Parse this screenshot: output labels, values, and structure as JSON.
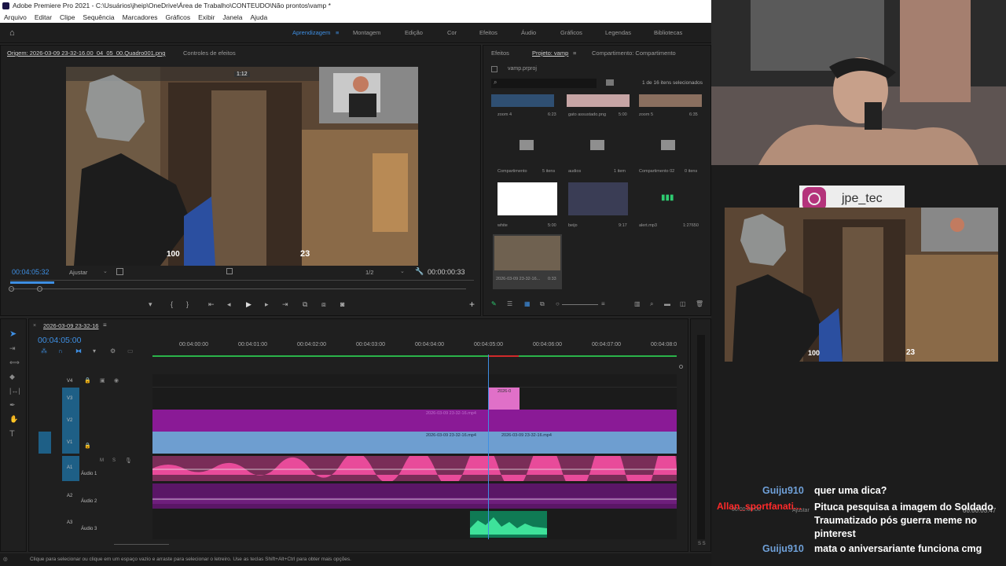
{
  "title_bar": "Adobe Premiere Pro 2021 - C:\\Usuários\\jheip\\OneDrive\\Área de Trabalho\\CONTEUDO\\Não prontos\\vamp *",
  "menu": [
    "Arquivo",
    "Editar",
    "Clipe",
    "Sequência",
    "Marcadores",
    "Gráficos",
    "Exibir",
    "Janela",
    "Ajuda"
  ],
  "workspaces": [
    "Aprendizagem",
    "Montagem",
    "Edição",
    "Cor",
    "Efeitos",
    "Áudio",
    "Gráficos",
    "Legendas",
    "Bibliotecas"
  ],
  "source_panel": {
    "tab_origin": "Origem: 2026-03-09 23-32-16.00_04_05_00.Quadro001.png",
    "tab_effects": "Controles de efeitos",
    "timecode_left": "00:04:05:32",
    "fit": "Ajustar",
    "resolution": "1/2",
    "timecode_right": "00:00:00:33",
    "hud_time": "1:12",
    "hud_score": "100",
    "hud_ammo": "23"
  },
  "project_panel": {
    "tab_effects": "Efeitos",
    "tab_project": "Projeto: vamp",
    "tab_shared": "Compartimento: Compartimento",
    "file": "vamp.prproj",
    "count": "1 de 16 itens selecionados",
    "items": [
      {
        "name": "zoom 4",
        "meta": "6:23"
      },
      {
        "name": "gato assustado.png",
        "meta": "5:00"
      },
      {
        "name": "zoom 5",
        "meta": "6:35"
      },
      {
        "name": "Compartimento",
        "meta": "5 itens"
      },
      {
        "name": "audios",
        "meta": "1 item"
      },
      {
        "name": "Compartimento 02",
        "meta": "0 itens"
      },
      {
        "name": "white",
        "meta": "5:00"
      },
      {
        "name": "beijo",
        "meta": "9:17"
      },
      {
        "name": "alert.mp3",
        "meta": "1:27650"
      },
      {
        "name": "2026-03-09 23-32-16...",
        "meta": "0:33"
      }
    ]
  },
  "timeline": {
    "sequence": "2026-03-09 23-32-16",
    "timecode": "00:04:05:00",
    "ruler": [
      "00:04:00:00",
      "00:04:01:00",
      "00:04:02:00",
      "00:04:03:00",
      "00:04:04:00",
      "00:04:05:00",
      "00:04:06:00",
      "00:04:07:00",
      "00:04:08:0"
    ],
    "tracks": [
      "V4",
      "V3",
      "V2",
      "V1",
      "A1",
      "A2",
      "A3"
    ],
    "audio_names": [
      "Áudio 1",
      "Áudio 2",
      "Áudio 3"
    ],
    "clip_v3": "2026-0",
    "clip_v2": "2026-03-09 23-32-16.mp4",
    "clip_v1a": "2026-03-09 23-32-16.mp4",
    "clip_v1b": "2026-03-09 23-32-16.mp4"
  },
  "status_bar": "Clique para selecionar ou clique em um espaço vazio e arraste para selecionar o letreiro. Use as teclas Shift+Alt+Ctrl para obter mais opções.",
  "overlay": {
    "instagram": "jpe_tec",
    "hud_score": "100",
    "hud_ammo": "23",
    "ghost_fit": "Ajustar",
    "ghost_tc": "00:00:03:47",
    "ghost_tc2": "00:00:00:00",
    "chat": [
      {
        "user": "Guiju910",
        "color": "#6fa0d8",
        "msg": "quer uma dica?"
      },
      {
        "user": "Allan_sportfanati...",
        "color": "#ff2a2a",
        "msg": "Pituca pesquisa a imagem do Soldado Traumatizado pós guerra meme no pinterest"
      },
      {
        "user": "Guiju910",
        "color": "#6fa0d8",
        "msg": "mata o aniversariante funciona cmg"
      }
    ]
  },
  "colors": {
    "accent": "#3e8fe3",
    "clip_purple": "#8a1a96",
    "clip_blue": "#6e9ed0",
    "clip_pink": "#e070c8",
    "audio_pink": "#e84b9a",
    "audio_green": "#1f9d6a",
    "playhead": "#3e8fe3"
  }
}
